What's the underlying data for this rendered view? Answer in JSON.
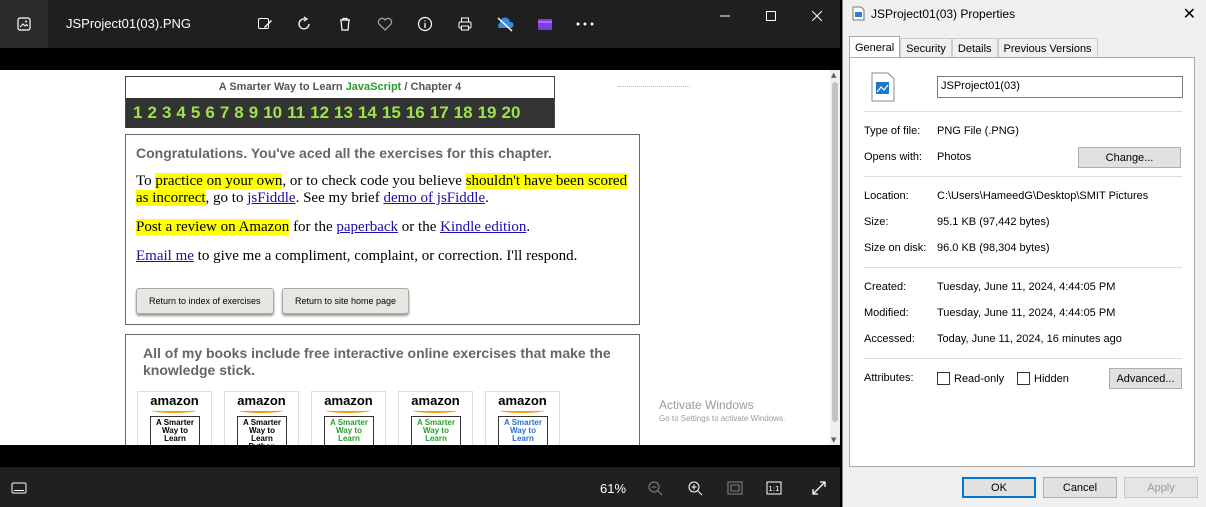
{
  "photos": {
    "title": "JSProject01(03).PNG",
    "zoom": "61%",
    "page": {
      "header_title_a": "A Smarter Way to Learn ",
      "header_title_js": "JavaScript",
      "header_title_b": "  /  Chapter 4",
      "chapter_numbers": [
        "1",
        "2",
        "3",
        "4",
        "5",
        "6",
        "7",
        "8",
        "9",
        "10",
        "11",
        "12",
        "13",
        "14",
        "15",
        "16",
        "17",
        "18",
        "19",
        "20"
      ],
      "congrats": "Congratulations. You've aced all the exercises for this chapter.",
      "p1_a": "To ",
      "p1_hl1": "practice on your own",
      "p1_b": ", or to check code you believe ",
      "p1_hl2": "shouldn't have been scored as incorrect",
      "p1_c": ", go to ",
      "p1_link1": "jsFiddle",
      "p1_d": ". See my brief ",
      "p1_link2": "demo of jsFiddle",
      "p1_e": ".",
      "p2_hl": "Post a review on Amazon",
      "p2_a": " for the ",
      "p2_link1": "paperback",
      "p2_b": " or the ",
      "p2_link2": "Kindle edition",
      "p2_c": ".",
      "p3_link": "Email me",
      "p3_a": " to give me a compliment, complaint, or correction. I'll respond.",
      "btn_index": "Return to index of exercises",
      "btn_home": "Return to site home page",
      "books_heading": "All of my books include free interactive online exercises that make the knowledge stick.",
      "books": [
        {
          "brand": "amazon",
          "cover": "A Smarter Way to Learn",
          "color": "#000000"
        },
        {
          "brand": "amazon",
          "cover": "A Smarter Way to Learn Python",
          "color": "#000000"
        },
        {
          "brand": "amazon",
          "cover": "A Smarter Way to Learn",
          "color": "#2a9d2a"
        },
        {
          "brand": "amazon",
          "cover": "A Smarter Way to Learn",
          "color": "#2a9d2a"
        },
        {
          "brand": "amazon",
          "cover": "A Smarter Way to Learn",
          "color": "#2a6fd1"
        }
      ],
      "activate_1": "Activate Windows",
      "activate_2": "Go to Settings to activate Windows."
    }
  },
  "dialog": {
    "title": "JSProject01(03) Properties",
    "tabs": [
      "General",
      "Security",
      "Details",
      "Previous Versions"
    ],
    "file_name": "JSProject01(03)",
    "type_label": "Type of file:",
    "type_value": "PNG File (.PNG)",
    "opens_label": "Opens with:",
    "opens_value": "Photos",
    "change_label": "Change...",
    "location_label": "Location:",
    "location_value": "C:\\Users\\HameedG\\Desktop\\SMIT Pictures",
    "size_label": "Size:",
    "size_value": "95.1 KB (97,442 bytes)",
    "disk_label": "Size on disk:",
    "disk_value": "96.0 KB (98,304 bytes)",
    "created_label": "Created:",
    "created_value": "Tuesday, June 11, 2024, 4:44:05 PM",
    "modified_label": "Modified:",
    "modified_value": "Tuesday, June 11, 2024, 4:44:05 PM",
    "accessed_label": "Accessed:",
    "accessed_value": "Today, June 11, 2024, 16 minutes ago",
    "attributes_label": "Attributes:",
    "readonly_label": "Read-only",
    "hidden_label": "Hidden",
    "advanced_label": "Advanced...",
    "ok_label": "OK",
    "cancel_label": "Cancel",
    "apply_label": "Apply"
  }
}
